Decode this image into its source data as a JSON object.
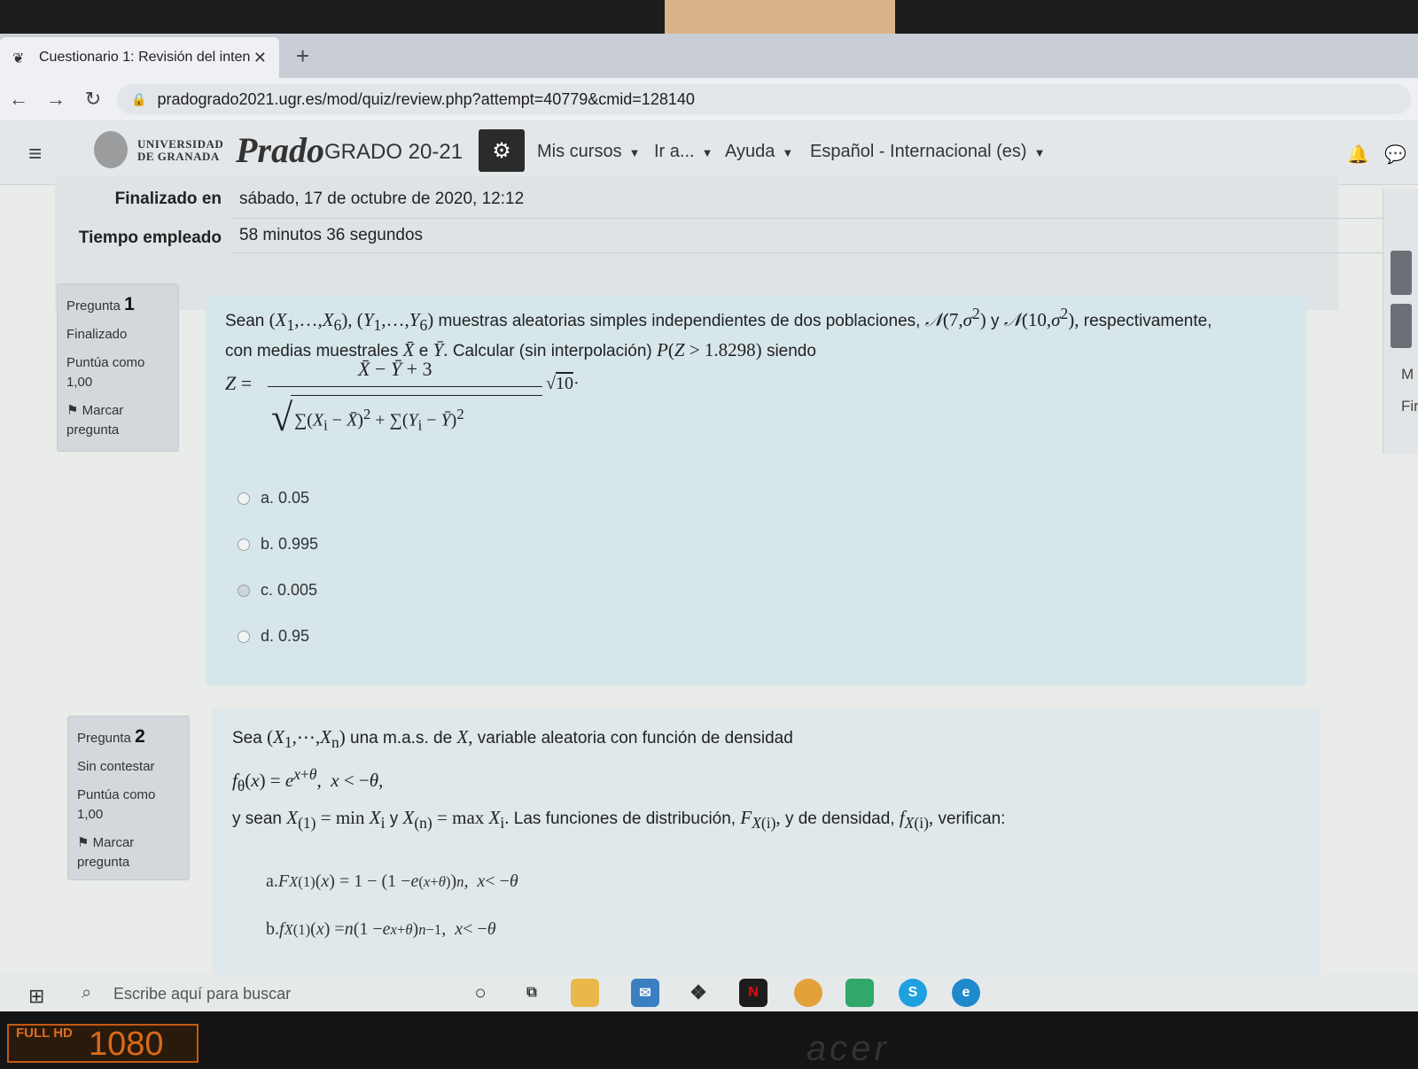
{
  "browser": {
    "tab_title": "Cuestionario 1: Revisión del inten",
    "tab_close": "✕",
    "new_tab": "+",
    "url": "pradogrado2021.ugr.es/mod/quiz/review.php?attempt=40779&cmid=128140"
  },
  "header": {
    "university_line1": "UNIVERSIDAD",
    "university_line2": "DE GRANADA",
    "platform_logo": "Prado",
    "course_label": "GRADO 20-21",
    "menu": [
      {
        "label": "Mis cursos"
      },
      {
        "label": "Ir a..."
      },
      {
        "label": "Ayuda"
      },
      {
        "label": "Español - Internacional (es)"
      }
    ]
  },
  "summary": {
    "rows": [
      {
        "label": "Finalizado en",
        "value": "sábado, 17 de octubre de 2020, 12:12"
      },
      {
        "label": "Tiempo empleado",
        "value": "58 minutos 36 segundos"
      }
    ]
  },
  "questions": [
    {
      "prefix": "Pregunta",
      "number": "1",
      "status": "Finalizado",
      "score": "Puntúa como 1,00",
      "flag": "Marcar pregunta",
      "text_line1": "muestras aleatorias simples independientes de dos poblaciones,",
      "text_line2a": "respectivamente,",
      "text_line2": "con medias muestrales",
      "text_line3": "Calcular (sin interpolación)",
      "text_line4": "siendo",
      "options": [
        {
          "label": "a. 0.05",
          "selected": false
        },
        {
          "label": "b. 0.995",
          "selected": false
        },
        {
          "label": "c. 0.005",
          "selected": true
        },
        {
          "label": "d. 0.95",
          "selected": false
        }
      ]
    },
    {
      "prefix": "Pregunta",
      "number": "2",
      "status": "Sin contestar",
      "score": "Puntúa como 1,00",
      "flag": "Marcar pregunta",
      "text_a": "una m.a.s. de",
      "text_b": "variable aleatoria con función de densidad",
      "text_c": "Las funciones de distribución,",
      "text_d": "y de densidad,",
      "text_e": "verifican:"
    }
  ],
  "side_panel": {
    "letter1": "M",
    "letter2": "Fir"
  },
  "taskbar": {
    "search_placeholder": "Escribe aquí para buscar",
    "apps": [
      "task-view",
      "file-explorer",
      "mail",
      "dropbox",
      "netflix",
      "chrome",
      "green-app",
      "skype",
      "edge"
    ]
  },
  "bezel": {
    "hd_text": "FULL HD",
    "resolution": "1080",
    "brand": "acer"
  },
  "colors": {
    "question_bg": "#d7e6ea",
    "info_bg": "#d3d8dc",
    "header_bg": "#e4e7ea"
  }
}
